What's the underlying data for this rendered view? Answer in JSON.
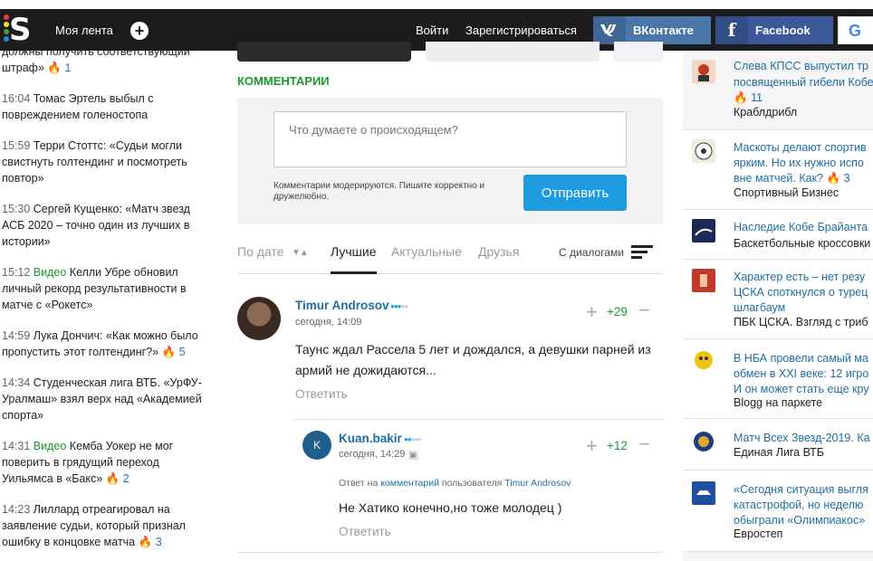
{
  "header": {
    "logo_letter": "S",
    "feed": "Моя лента",
    "plus": "+",
    "login": "Войти",
    "register": "Зарегистрироваться",
    "vk_icon": "vk-icon",
    "vk_label": "ВКонтакте",
    "fb_icon": "facebook-icon",
    "fb_label": "Facebook",
    "g_icon": "google-icon",
    "colors": {
      "bg": "#1c1c1c",
      "vk": "#4a76a8",
      "fb": "#3b5998"
    }
  },
  "left_news": [
    {
      "time": "",
      "video": "",
      "text": "должны получить соответствующий штраф»",
      "count": "1"
    },
    {
      "time": "16:04",
      "video": "",
      "text": "Томас Эртель выбыл с повреждением голеностопа",
      "count": ""
    },
    {
      "time": "15:59",
      "video": "",
      "text": "Терри Стоттс: «Судьи могли свистнуть голтендинг и посмотреть повтор»",
      "count": ""
    },
    {
      "time": "15:30",
      "video": "",
      "text": "Сергей Кущенко: «Матч звезд АСБ 2020 – точно один из лучших в истории»",
      "count": ""
    },
    {
      "time": "15:12",
      "video": "Видео",
      "text": "Келли Убре обновил личный рекорд результативности в матче с «Рокетс»",
      "count": ""
    },
    {
      "time": "14:59",
      "video": "",
      "text": "Лука Дончич: «Как можно было пропустить этот голтендинг?»",
      "count": "5"
    },
    {
      "time": "14:34",
      "video": "",
      "text": "Студенческая лига ВТБ. «УрФУ-Уралмаш» взял верх над «Академией спорта»",
      "count": ""
    },
    {
      "time": "14:31",
      "video": "Видео",
      "text": "Кемба Уокер не мог поверить в грядущий переход Уильямса в «Бакс»",
      "count": "2"
    },
    {
      "time": "14:23",
      "video": "",
      "text": "Лиллард отреагировал на заявление судьи, который признал ошибку в концовке матча",
      "count": "3"
    }
  ],
  "comments_section": {
    "heading": "КОММЕНТАРИИ",
    "input_placeholder": "Что думаете о происходящем?",
    "note": "Комментарии модерируются. Пишите корректно и дружелюбно.",
    "send": "Отправить",
    "sort": {
      "by_date": "По дате",
      "best": "Лучшие",
      "actual": "Актуальные",
      "friends": "Друзья",
      "dialogs": "С диалогами"
    },
    "comment1": {
      "user": "Timur Androsov",
      "rank_on": 3,
      "rank_total": 5,
      "date": "сегодня, 14:09",
      "device_icon": "apple-icon",
      "text": "Таунс ждал Рассела 5 лет и дождался, а девушки парней из армий не дожидаются...",
      "reply": "Ответить",
      "score": "+29"
    },
    "comment2": {
      "avatar_letter": "K",
      "user": "Kuan.bakir",
      "rank_on": 2,
      "rank_total": 5,
      "date": "сегодня, 14:29",
      "device_icon": "android-icon",
      "reply_prefix": "Ответ на",
      "reply_link": "комментарий",
      "reply_mid": "пользователя",
      "reply_user": "Timur Androsov",
      "text": "Не Хатико конечно,но тоже молодец )",
      "reply": "Ответить",
      "score": "+12"
    }
  },
  "right_news": [
    {
      "icon": "krabldribl-logo-icon",
      "title1": "Слева КПСС выпустил тр",
      "title2": "посвященный гибели Кобе",
      "count": "11",
      "source": "Краблдрибл"
    },
    {
      "icon": "football-icon",
      "title1": "Маскоты делают спортив",
      "title2": "ярким. Но их нужно испо",
      "title3": "вне матчей. Как?",
      "count": "3",
      "source": "Спортивный Бизнес"
    },
    {
      "icon": "basketball-shoes-icon",
      "title1": "Наследие Кобе Брайанта",
      "source": "Баскетбольные кроссовки"
    },
    {
      "icon": "cska-icon",
      "title1": "Характер есть – нет резу",
      "title2": "ЦСКА споткнулся о турец",
      "title3": "шлагбаум",
      "source": "ПБК ЦСКА. Взгляд с триб"
    },
    {
      "icon": "blogg-icon",
      "title1": "В НБА провели самый ма",
      "title2": "обмен в XXI веке: 12 игро",
      "title3": "И он может стать еще кру",
      "source": "Blogg на паркете"
    },
    {
      "icon": "vtb-league-icon",
      "title1": "Матч Всех Звезд-2019. Ка",
      "source": "Единая Лига ВТБ"
    },
    {
      "icon": "zenit-icon",
      "title1": "«Сегодня ситуация выгля",
      "title2": "катастрофой, но неделю",
      "title3": "обыграли «Олимпиакос»",
      "source": "Евростеп"
    }
  ]
}
